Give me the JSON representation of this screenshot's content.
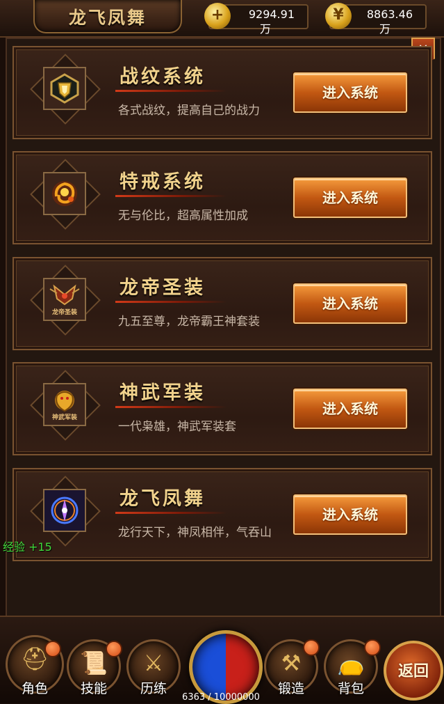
{
  "header": {
    "title": "龙飞凤舞",
    "resources": [
      {
        "icon": "gold-coin-icon",
        "value": "9294.91",
        "unit": "万"
      },
      {
        "icon": "gold-ingot-icon",
        "value": "8863.46",
        "unit": "万"
      }
    ],
    "close_label": "×"
  },
  "systems": [
    {
      "name": "战纹系统",
      "desc": "各式战纹，提高自己的战力",
      "button": "进入系统",
      "icon": "shield-icon"
    },
    {
      "name": "特戒系统",
      "desc": "无与伦比，超高属性加成",
      "button": "进入系统",
      "icon": "ring-icon"
    },
    {
      "name": "龙帝圣装",
      "desc": "九五至尊，龙帝霸王神套装",
      "button": "进入系统",
      "icon": "dragon-armor-icon"
    },
    {
      "name": "神武军装",
      "desc": "一代枭雄，神武军装套",
      "button": "进入系统",
      "icon": "war-armor-icon"
    },
    {
      "name": "龙飞凤舞",
      "desc": "龙行天下，神凤相伴，气吞山",
      "button": "进入系统",
      "icon": "phoenix-icon"
    }
  ],
  "icon_labels": {
    "dragon_armor": "龙帝圣装",
    "war_armor": "神武军装"
  },
  "exp_popup": "经验 +15",
  "bottom_nav": {
    "role": "角色",
    "skill": "技能",
    "training": "历练",
    "exp_progress": "6363 / 10000000",
    "forge": "锻造",
    "bag": "背包",
    "back": "返回"
  }
}
